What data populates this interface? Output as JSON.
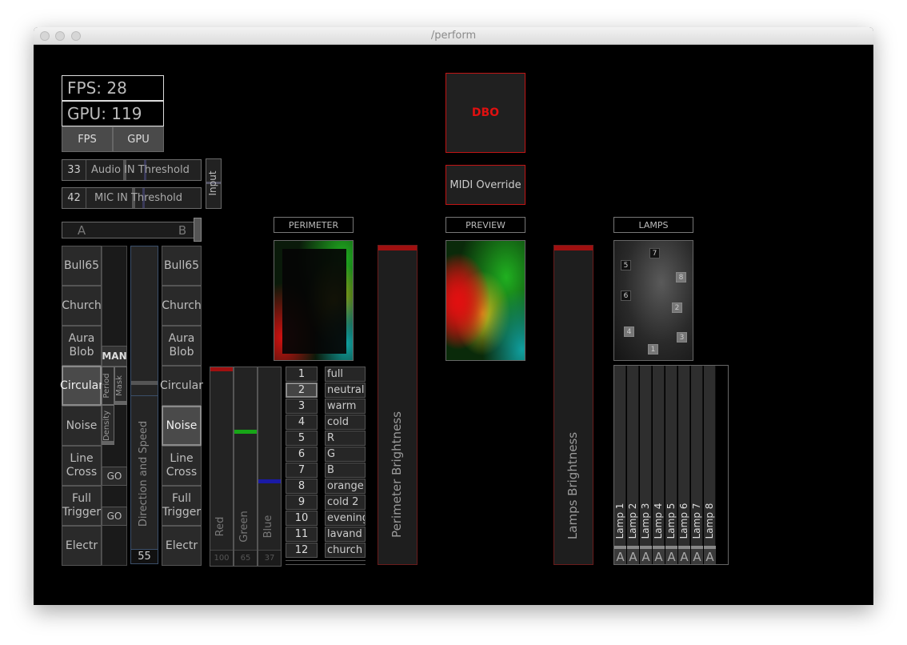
{
  "window": {
    "title": "/perform"
  },
  "stats": {
    "fps_label": "FPS: 28",
    "gpu_label": "GPU: 119",
    "fps_button": "FPS",
    "gpu_button": "GPU"
  },
  "input": {
    "audio_value": "33",
    "audio_label": "Audio IN Threshold",
    "mic_value": "42",
    "mic_label": "MIC IN Threshold",
    "input_label": "Input"
  },
  "crossfader": {
    "a": "A",
    "b": "B"
  },
  "patterns_left": [
    "Bull65",
    "Church",
    "Aura Blob",
    "Circular",
    "Noise",
    "Line Cross",
    "Full Trigger",
    "Electr"
  ],
  "patterns_right": [
    "Bull65",
    "Church",
    "Aura Blob",
    "Circular",
    "Noise",
    "Line Cross",
    "Full Trigger",
    "Electr"
  ],
  "active_left": "Circular",
  "active_right": "Noise",
  "controls": {
    "man": "MAN",
    "period": "Period",
    "mask": "Mask",
    "density": "Density",
    "go1": "GO",
    "go2": "GO"
  },
  "direction": {
    "label": "Direction and Speed",
    "value": "55"
  },
  "rgb": {
    "labels": [
      "Red",
      "Green",
      "Blue"
    ],
    "values": [
      "100",
      "65",
      "37"
    ],
    "levels": [
      1.0,
      0.65,
      0.37
    ],
    "colors": [
      "#a01010",
      "#17a617",
      "#1a1aa6"
    ]
  },
  "presets": {
    "numbers": [
      "1",
      "2",
      "3",
      "4",
      "5",
      "6",
      "7",
      "8",
      "9",
      "10",
      "11",
      "12"
    ],
    "names": [
      "full",
      "neutral",
      "warm",
      "cold",
      "R",
      "G",
      "B",
      "orange",
      "cold 2",
      "evening",
      "lavand",
      "church"
    ],
    "selected": "2"
  },
  "perimeter": {
    "header": "PERIMETER",
    "brightness_label": "Perimeter Brightness",
    "level": 1.0
  },
  "preview": {
    "header": "PREVIEW"
  },
  "lamps": {
    "header": "LAMPS",
    "brightness_label": "Lamps Brightness",
    "level": 1.0,
    "markers": [
      "7",
      "5",
      "8",
      "6",
      "2",
      "4",
      "3",
      "1"
    ],
    "faders": [
      "Lamp 1",
      "Lamp 2",
      "Lamp 3",
      "Lamp 4",
      "Lamp 5",
      "Lamp 6",
      "Lamp 7",
      "Lamp 8"
    ],
    "fader_buttons": [
      "A",
      "A",
      "A",
      "A",
      "A",
      "A",
      "A",
      "A"
    ]
  },
  "dbo": {
    "label": "DBO",
    "color": "#e01010"
  },
  "midi": {
    "label": "MIDI Override"
  }
}
